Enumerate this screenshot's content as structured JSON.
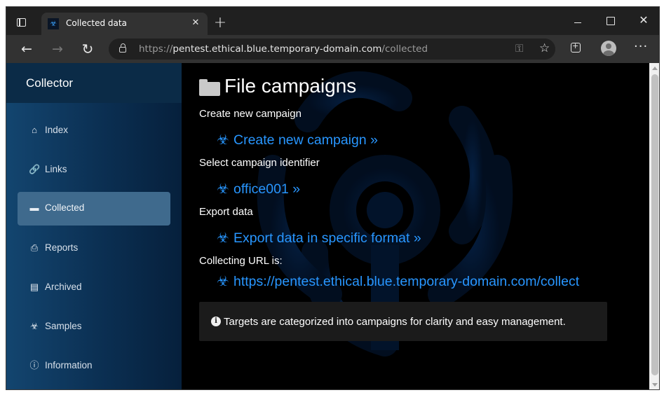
{
  "browser": {
    "tab_title": "Collected data",
    "url_prefix": "https://",
    "url_host": "pentest.ethical.blue.temporary-domain.com",
    "url_path": "/collected"
  },
  "sidebar": {
    "brand": "Collector",
    "items": [
      {
        "label": "Index",
        "icon": "home-icon",
        "active": false
      },
      {
        "label": "Links",
        "icon": "link-icon",
        "active": false
      },
      {
        "label": "Collected",
        "icon": "folder-icon",
        "active": true
      },
      {
        "label": "Reports",
        "icon": "printer-icon",
        "active": false
      },
      {
        "label": "Archived",
        "icon": "archive-icon",
        "active": false
      },
      {
        "label": "Samples",
        "icon": "biohazard-icon",
        "active": false
      },
      {
        "label": "Information",
        "icon": "info-icon",
        "active": false
      }
    ]
  },
  "main": {
    "title": "File campaigns",
    "sections": [
      {
        "label": "Create new campaign",
        "link": "Create new campaign »"
      },
      {
        "label": "Select campaign identifier",
        "link": "office001 »"
      },
      {
        "label": "Export data",
        "link": "Export data in specific format »"
      },
      {
        "label": "Collecting URL is:",
        "link": "https://pentest.ethical.blue.temporary-domain.com/collect"
      }
    ],
    "note": "Targets are categorized into campaigns for clarity and easy management."
  },
  "colors": {
    "link": "#2896ff",
    "sidebar_active": "#3f6a8d",
    "background": "#000000"
  }
}
